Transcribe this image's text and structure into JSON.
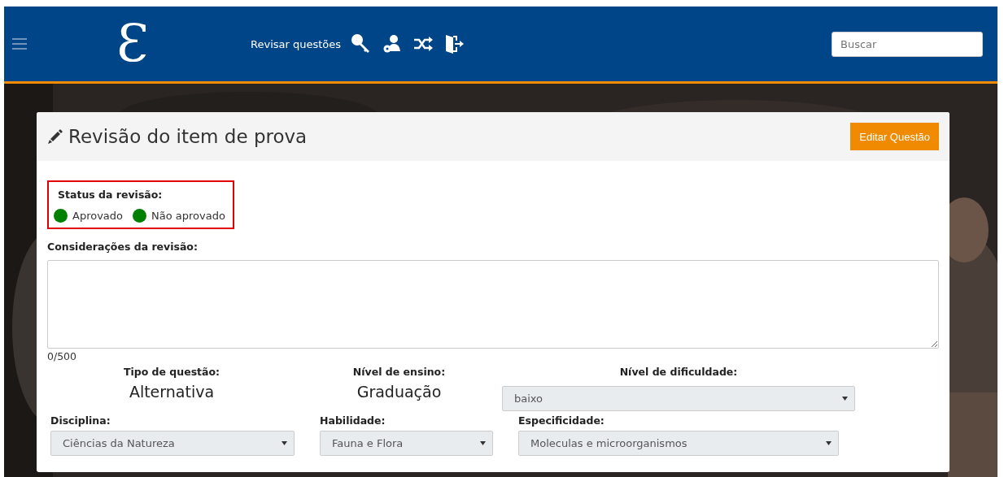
{
  "navbar": {
    "logo": "Ɛ",
    "link": "Revisar questões",
    "search": {
      "placeholder": "Buscar"
    }
  },
  "card": {
    "title": "Revisão do item de prova",
    "edit_button": "Editar Questão",
    "status": {
      "label": "Status da revisão:",
      "options": [
        {
          "label": "Aprovado",
          "color": "#008000"
        },
        {
          "label": "Não aprovado",
          "color": "#008000"
        }
      ]
    },
    "considerations": {
      "label": "Considerações da revisão:",
      "counter": "0/500"
    },
    "info": [
      {
        "label": "Tipo de questão:",
        "value": "Alternativa",
        "kind": "text"
      },
      {
        "label": "Nível de ensino:",
        "value": "Graduação",
        "kind": "text"
      },
      {
        "label": "Nível de dificuldade:",
        "value": "baixo",
        "kind": "select"
      }
    ],
    "selects": [
      {
        "label": "Disciplina:",
        "value": "Ciências da Natureza"
      },
      {
        "label": "Habilidade:",
        "value": "Fauna e Flora"
      },
      {
        "label": "Especificidade:",
        "value": "Moleculas e microorganismos"
      }
    ]
  }
}
